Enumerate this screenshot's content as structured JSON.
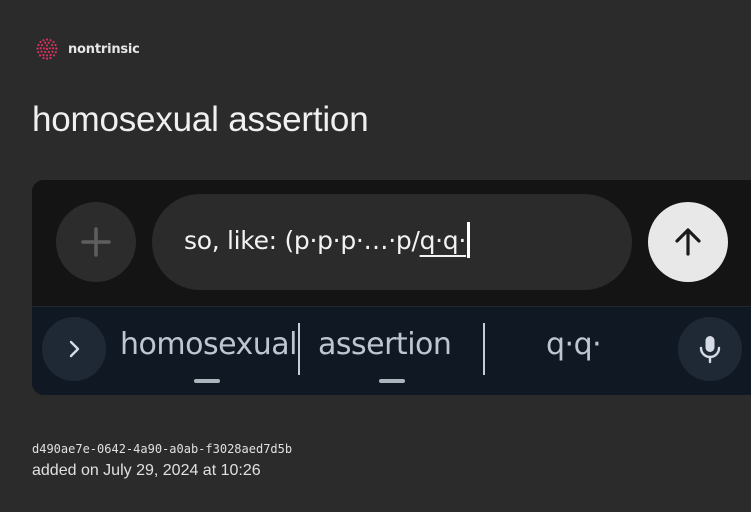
{
  "brand": {
    "name": "nontrinsic",
    "logo_icon": "dotted-globe-icon",
    "logo_color": "#d6335f"
  },
  "title": "homosexual assertion",
  "screenshot": {
    "compose": {
      "plus_icon": "plus-icon",
      "input_committed": "so, like: (p·p·p·…·p/",
      "input_composing": "q·q·",
      "send_icon": "arrow-up-icon"
    },
    "keyboard": {
      "expand_icon": "chevron-right-icon",
      "suggestions": [
        "homosexual",
        "assertion",
        "q·q·"
      ],
      "mic_icon": "microphone-icon"
    }
  },
  "meta": {
    "id": "d490ae7e-0642-4a90-a0ab-f3028aed7d5b",
    "date": "added on July 29, 2024 at 10:26"
  }
}
